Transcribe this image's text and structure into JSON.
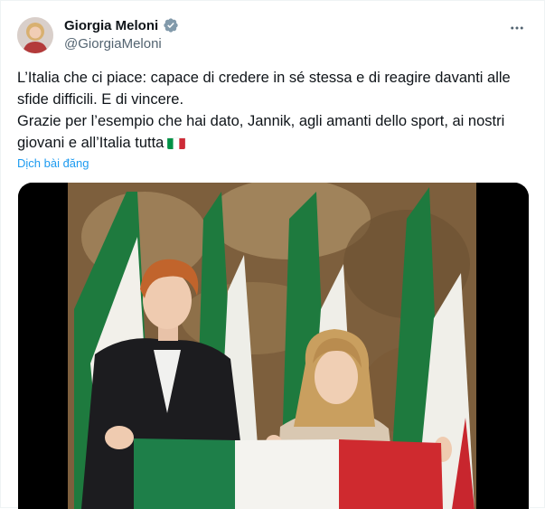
{
  "author": {
    "display_name": "Giorgia Meloni",
    "handle": "@GiorgiaMeloni"
  },
  "tweet": {
    "lines": [
      "L’Italia che ci piace: capace di credere in sé stessa e di reagire davanti alle sfide difficili. E di vincere.",
      "Grazie per l’esempio che hai dato, Jannik, agli amanti dello sport, ai nostri giovani e all’Italia tutta"
    ],
    "translate_label": "Dịch bài đăng"
  },
  "icons": {
    "verified": "verified-badge-icon",
    "more": "more-options-icon",
    "flag": "italy-flag-icon"
  },
  "colors": {
    "link": "#1d9bf0",
    "secondary_text": "#536471",
    "verified_badge": "#829aab"
  }
}
